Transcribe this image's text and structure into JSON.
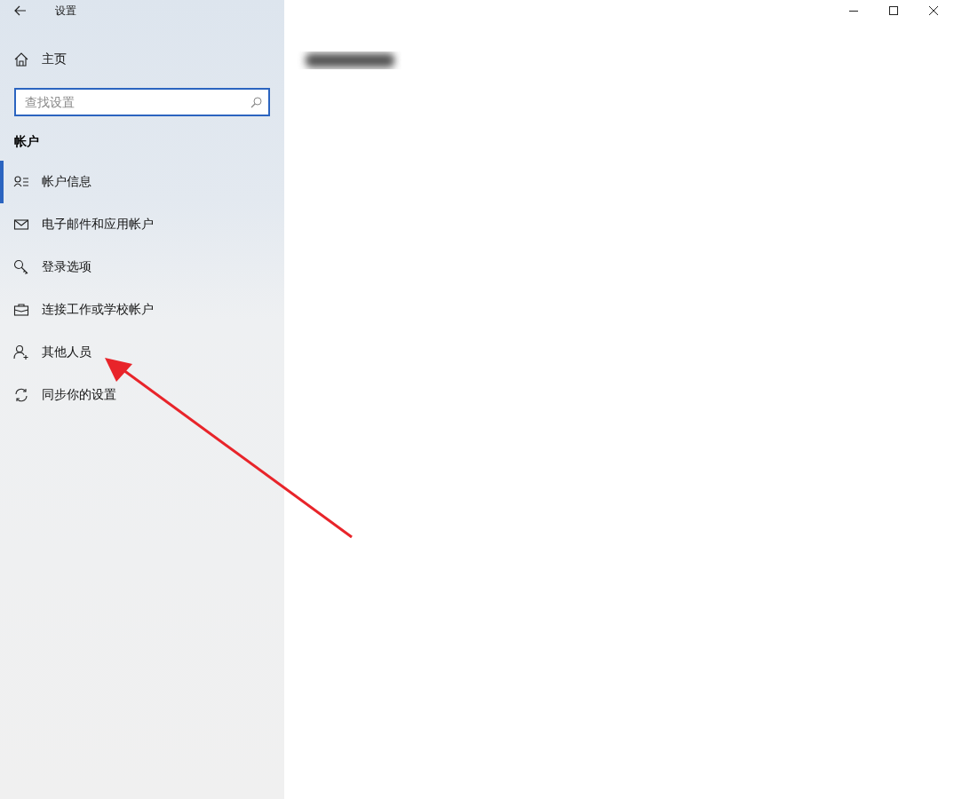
{
  "window": {
    "title": "设置"
  },
  "sidebar": {
    "home": "主页",
    "search": {
      "placeholder": "查找设置"
    },
    "section": "帐户",
    "items": [
      {
        "label": "帐户信息",
        "selected": true
      },
      {
        "label": "电子邮件和应用帐户",
        "selected": false
      },
      {
        "label": "登录选项",
        "selected": false
      },
      {
        "label": "连接工作或学校帐户",
        "selected": false
      },
      {
        "label": "其他人员",
        "selected": false
      },
      {
        "label": "同步你的设置",
        "selected": false
      }
    ]
  }
}
